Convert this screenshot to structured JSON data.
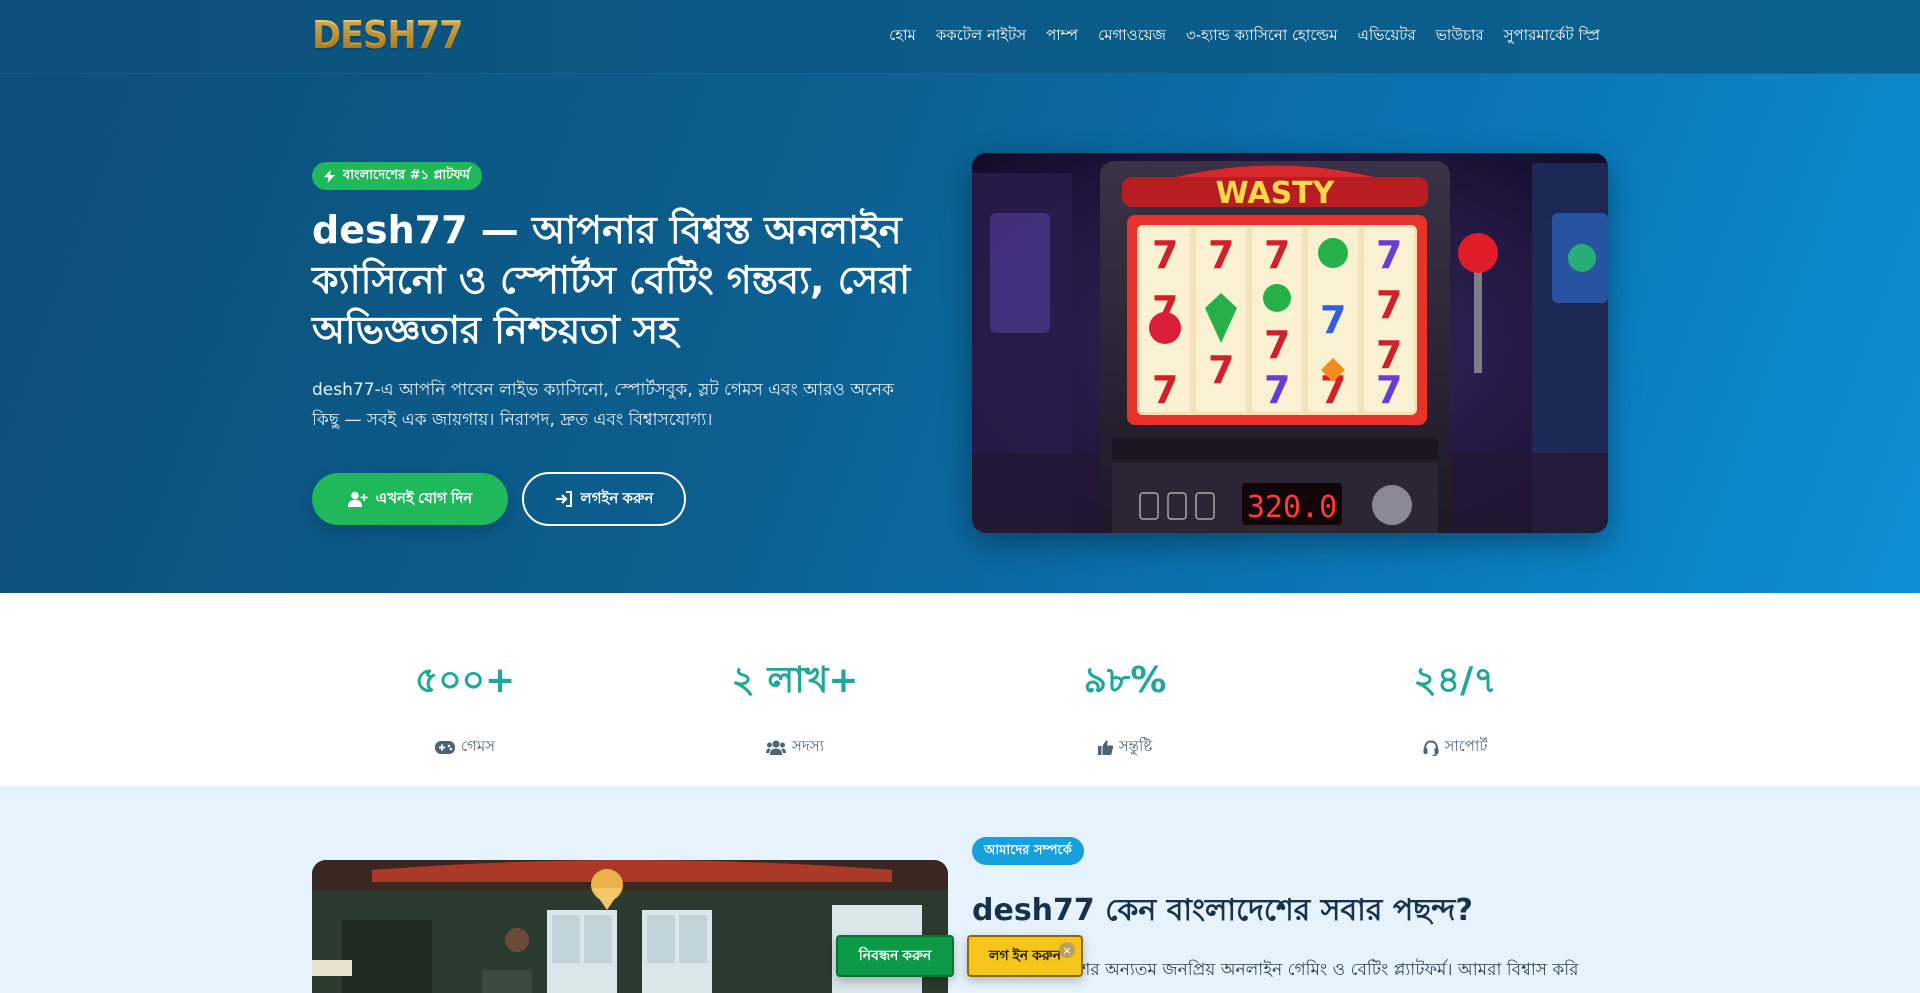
{
  "header": {
    "logo_text": "DESH77",
    "nav": [
      "হোম",
      "ককটেল নাইটস",
      "পাম্প",
      "মেগাওয়েজ",
      "৩-হ্যান্ড ক্যাসিনো হোল্ডেম",
      "এভিয়েটর",
      "ভাউচার",
      "সুপারমার্কেট স্প্রি"
    ]
  },
  "hero": {
    "badge": "বাংলাদেশের #১ প্লাটফর্ম",
    "title": "desh77 — আপনার বিশ্বস্ত অনলাইন ক্যাসিনো ও স্পোর্টস বেটিং গন্তব্য, সেরা অভিজ্ঞতার নিশ্চয়তা সহ",
    "description": "desh77-এ আপনি পাবেন লাইভ ক্যাসিনো, স্পোর্টসবুক, স্লট গেমস এবং আরও অনেক কিছু — সবই এক জায়গায়। নিরাপদ, দ্রুত এবং বিশ্বাসযোগ্য।",
    "join_button": "এখনই যোগ দিন",
    "login_button": "লগইন করুন",
    "slot_title": "WASTY",
    "slot_display": "320.0"
  },
  "stats": [
    {
      "value": "৫০০+",
      "label": "গেমস",
      "icon": "gamepad-icon"
    },
    {
      "value": "২ লাখ+",
      "label": "সদস্য",
      "icon": "users-icon"
    },
    {
      "value": "৯৮%",
      "label": "সন্তুষ্টি",
      "icon": "thumbs-up-icon"
    },
    {
      "value": "২৪/৭",
      "label": "সাপোর্ট",
      "icon": "headset-icon"
    }
  ],
  "about": {
    "badge": "আমাদের সম্পর্কে",
    "title": "desh77 কেন বাংলাদেশের সবার পছন্দ?",
    "text": "লাদেশের অন্যতম জনপ্রিয় অনলাইন গেমিং ও বেটিং প্ল্যাটফর্ম। আমরা বিশ্বাস করি"
  },
  "floating": {
    "register": "নিবন্ধন করুন",
    "login": "লগ ইন করুন",
    "close": "×"
  },
  "colors": {
    "accent_green": "#1fb85a",
    "stat_teal": "#20a69a",
    "header_blue": "#0c4f78",
    "login_yellow": "#f6c51b"
  }
}
